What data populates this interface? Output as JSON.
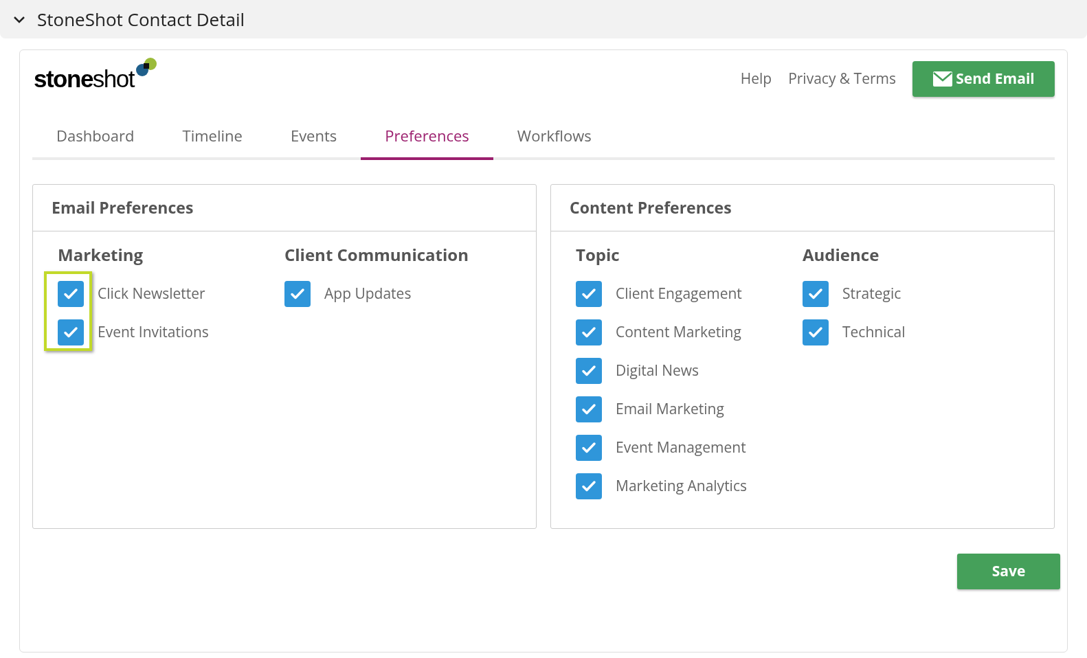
{
  "header": {
    "title": "StoneShot Contact Detail",
    "expanded": true
  },
  "logo": {
    "text": "**stone**shot"
  },
  "top_links": [
    "Help",
    "Privacy & Terms"
  ],
  "send_button": "Send Email",
  "tabs": [
    {
      "label": "Dashboard",
      "selected": false
    },
    {
      "label": "Timeline",
      "selected": false
    },
    {
      "label": "Events",
      "selected": false
    },
    {
      "label": "Preferences",
      "selected": true
    },
    {
      "label": "Workflows",
      "selected": false
    }
  ],
  "panels": [
    {
      "title": "Email Preferences",
      "groups": [
        {
          "title": "Marketing",
          "highlighted": true,
          "items": [
            {
              "label": "Click Newsletter",
              "checked": true
            },
            {
              "label": "Event Invitations",
              "checked": true
            }
          ]
        },
        {
          "title": "Client Communication",
          "highlighted": false,
          "items": [
            {
              "label": "App Updates",
              "checked": true
            }
          ]
        }
      ]
    },
    {
      "title": "Content Preferences",
      "groups": [
        {
          "title": "Topic",
          "highlighted": false,
          "items": [
            {
              "label": "Client Engagement",
              "checked": true
            },
            {
              "label": "Content Marketing",
              "checked": true
            },
            {
              "label": "Digital News",
              "checked": true
            },
            {
              "label": "Email Marketing",
              "checked": true
            },
            {
              "label": "Event Management",
              "checked": true
            },
            {
              "label": "Marketing Analytics",
              "checked": true
            }
          ]
        },
        {
          "title": "Audience",
          "highlighted": false,
          "items": [
            {
              "label": "Strategic",
              "checked": true
            },
            {
              "label": "Technical",
              "checked": true
            }
          ]
        }
      ]
    }
  ],
  "save_button": "Save"
}
